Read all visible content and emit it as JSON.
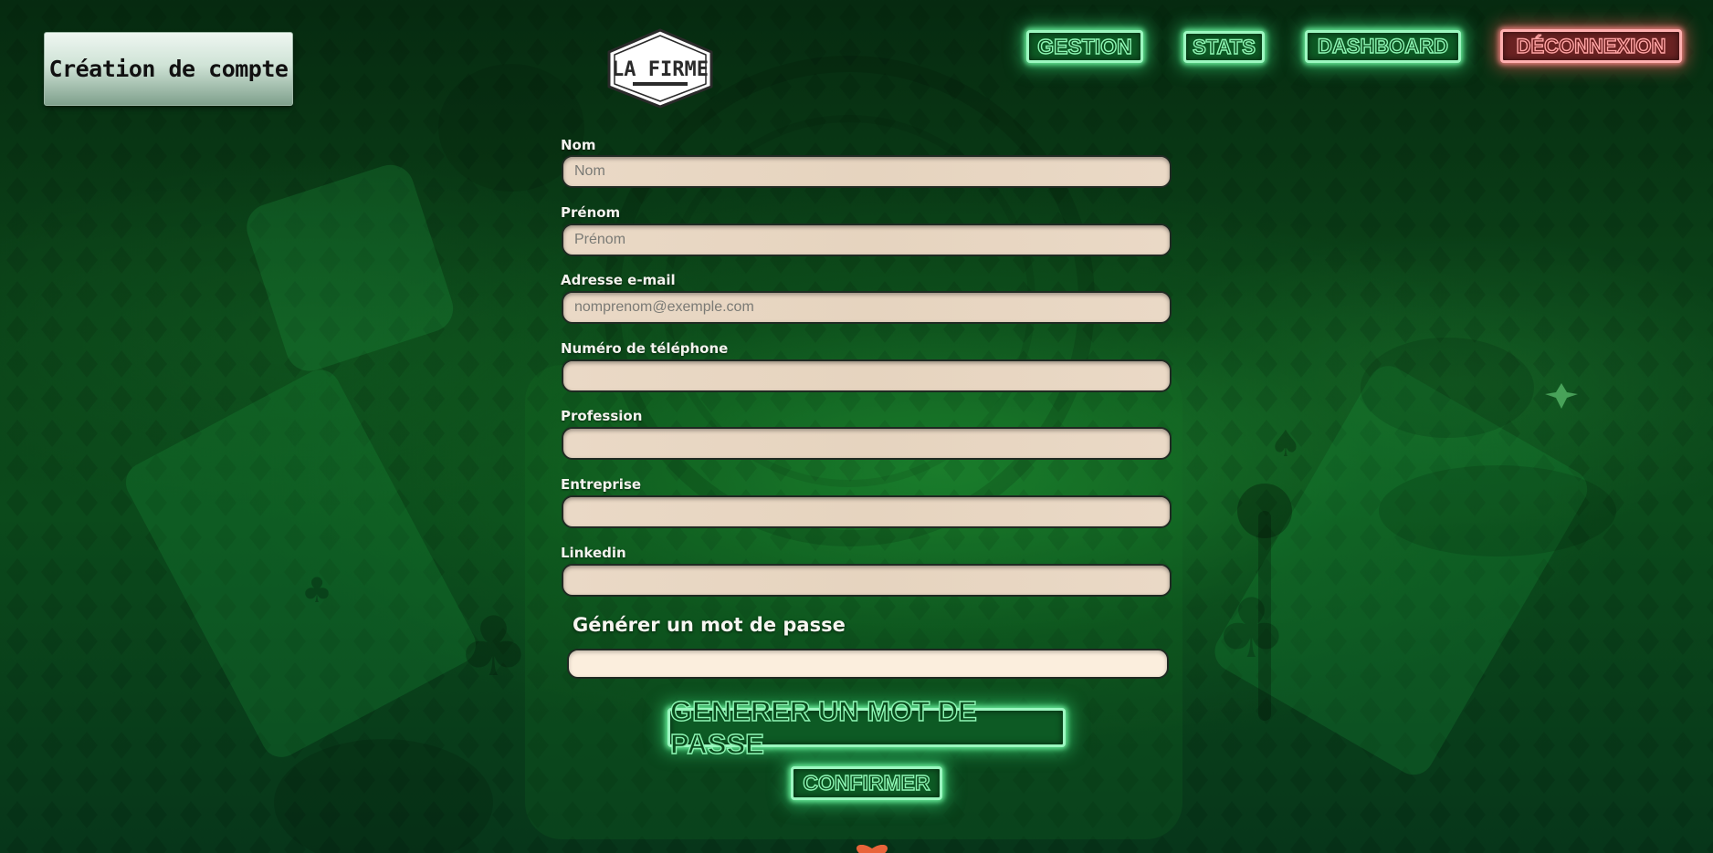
{
  "header": {
    "page_label": "Création de compte",
    "logo_text": "LA FIRME"
  },
  "nav": {
    "gestion": "GESTION",
    "stats": "STATS",
    "dashboard": "DASHBOARD",
    "deconnexion": "DÉCONNEXION"
  },
  "form": {
    "fields": [
      {
        "label": "Nom",
        "placeholder": "Nom",
        "value": ""
      },
      {
        "label": "Prénom",
        "placeholder": "Prénom",
        "value": ""
      },
      {
        "label": "Adresse e-mail",
        "placeholder": "nomprenom@exemple.com",
        "value": ""
      },
      {
        "label": "Numéro de téléphone",
        "placeholder": "",
        "value": ""
      },
      {
        "label": "Profession",
        "placeholder": "",
        "value": ""
      },
      {
        "label": "Entreprise",
        "placeholder": "",
        "value": ""
      },
      {
        "label": "Linkedin",
        "placeholder": "",
        "value": ""
      }
    ],
    "password_title": "Générer un mot de passe",
    "password_value": "",
    "generate_label": "GENERER UN MOT DE PASSE",
    "confirm_label": "CONFIRMER"
  },
  "colors": {
    "neon_green": "#9cf7c0",
    "neon_red": "#ffb0b0",
    "input_bg": "#ead9c6"
  }
}
